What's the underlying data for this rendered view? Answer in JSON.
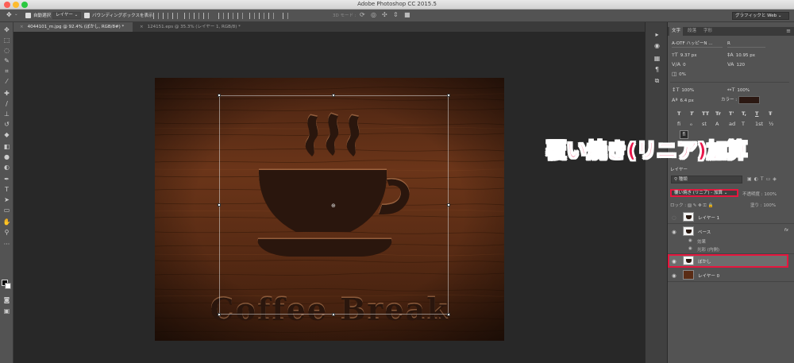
{
  "window": {
    "title": "Adobe Photoshop CC 2015.5"
  },
  "options_bar": {
    "auto_select_label": "自動選択 :",
    "auto_select_value": "レイヤー",
    "bounding_box_label": "バウンディングボックスを表示",
    "mode_3d_label": "3D モード :",
    "workspace": "グラフィックと Web"
  },
  "doc_tabs": [
    {
      "label": "4044101_m.jpg @ 92.4% (ぼかし, RGB/8#) *"
    },
    {
      "label": "124151.eps @ 35.3% (レイヤー 1, RGB/8) *"
    }
  ],
  "artwork": {
    "text": "Coffee Break"
  },
  "character_panel": {
    "tabs": [
      "文字",
      "段落",
      "字形"
    ],
    "font_family": "A-OTF ハッピーN ...",
    "font_style": "R",
    "font_size": "9.37 px",
    "leading": "10.95 px",
    "kerning": "0",
    "tracking": "120",
    "tsume": "0%",
    "vscale": "100%",
    "hscale": "100%",
    "baseline": "6.4 px",
    "color_label": "カラー :",
    "style_buttons": [
      "T",
      "T",
      "TT",
      "Tr",
      "T'",
      "T,",
      "T",
      "Ŧ"
    ],
    "ot_buttons": [
      "fi",
      "ℴ",
      "st",
      "A",
      "ad",
      "T",
      "1st",
      "½"
    ],
    "fi_button": "fi",
    "color": "#2b1812"
  },
  "layers_panel": {
    "tab": "レイヤー",
    "search_kind": "種類",
    "blend_mode": "覆い焼き (リニア) - 加算",
    "opacity_label": "不透明度 :",
    "opacity": "100%",
    "lock_label": "ロック :",
    "fill_label": "塗り :",
    "fill": "100%",
    "layers": [
      {
        "name": "レイヤー 1",
        "visible": false,
        "has_fx": false
      },
      {
        "name": "ベース",
        "visible": true,
        "has_fx": true
      },
      {
        "name": "ぼかし",
        "visible": true,
        "has_fx": false,
        "selected": true
      },
      {
        "name": "レイヤー 0",
        "visible": true,
        "has_fx": false
      }
    ],
    "effects_label": "効果",
    "effect_inner_shadow": "光彩 (内側)",
    "fx_label": "fx"
  },
  "callout": {
    "text": "覆い焼き(リニア)加算",
    "color": "#e8164a"
  }
}
